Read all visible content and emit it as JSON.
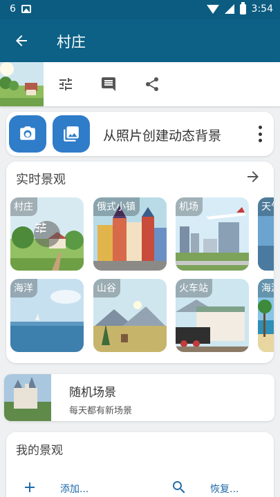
{
  "status_bar": {
    "notification_count": "6",
    "time": "3:54"
  },
  "app_bar": {
    "title": "村庄",
    "back_icon": "arrow-back-icon"
  },
  "toolbar": {
    "icons": [
      "tune-icon",
      "comment-icon",
      "share-icon"
    ]
  },
  "photo_card": {
    "label": "从照片创建动态背景",
    "accent": "#2f7cc9"
  },
  "live_scenes": {
    "title": "实时景观",
    "tiles": [
      {
        "label": "村庄"
      },
      {
        "label": "俄式小镇"
      },
      {
        "label": "机场"
      },
      {
        "label": "天气"
      },
      {
        "label": "海洋"
      },
      {
        "label": "山谷"
      },
      {
        "label": "火车站"
      },
      {
        "label": "海滩"
      }
    ]
  },
  "random_scene": {
    "title": "随机场景",
    "subtitle": "每天都有新场景"
  },
  "my_scenes": {
    "title": "我的景观",
    "add_label": "添加...",
    "restore_label": "恢复..."
  },
  "colors": {
    "status_bar": "#0b5c80",
    "app_bar": "#0d6187",
    "accent": "#2f7cc9",
    "link": "#1e6aa8"
  }
}
